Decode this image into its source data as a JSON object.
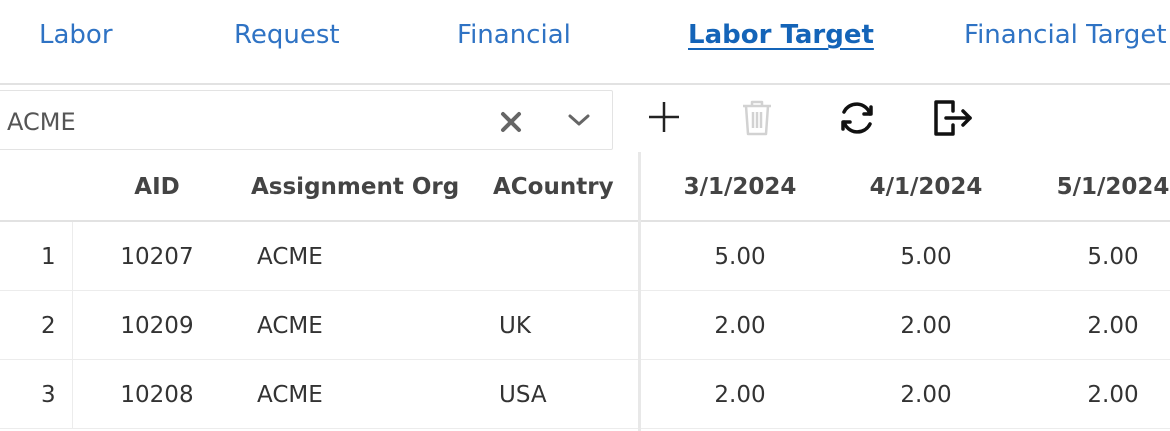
{
  "tabs": [
    {
      "label": "Labor",
      "active": false
    },
    {
      "label": "Request",
      "active": false
    },
    {
      "label": "Financial",
      "active": false
    },
    {
      "label": "Labor Target",
      "active": true
    },
    {
      "label": "Financial Target",
      "active": false
    }
  ],
  "filter": {
    "value": "ACME",
    "clear_icon": "close-icon",
    "dropdown_icon": "chevron-down-icon"
  },
  "toolbar": {
    "add_icon": "plus-icon",
    "delete_icon": "trash-icon",
    "delete_disabled": true,
    "refresh_icon": "refresh-icon",
    "export_icon": "export-icon"
  },
  "grid": {
    "columns": [
      "AID",
      "Assignment Org",
      "ACountry",
      "3/1/2024",
      "4/1/2024",
      "5/1/2024"
    ],
    "rows": [
      {
        "num": "1",
        "aid": "10207",
        "org": "ACME",
        "country": "",
        "v1": "5.00",
        "v2": "5.00",
        "v3": "5.00"
      },
      {
        "num": "2",
        "aid": "10209",
        "org": "ACME",
        "country": "UK",
        "v1": "2.00",
        "v2": "2.00",
        "v3": "2.00"
      },
      {
        "num": "3",
        "aid": "10208",
        "org": "ACME",
        "country": "USA",
        "v1": "2.00",
        "v2": "2.00",
        "v3": "2.00"
      }
    ]
  },
  "colors": {
    "accent": "#2f73c4",
    "active_tab": "#1464b8",
    "border": "#e2e2e2"
  }
}
